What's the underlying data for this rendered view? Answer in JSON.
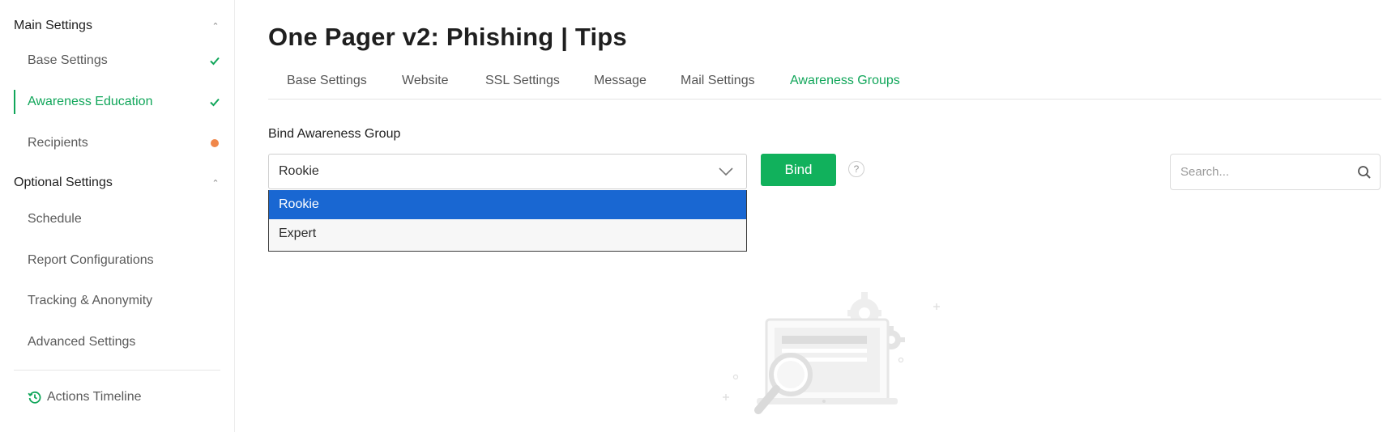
{
  "sidebar": {
    "main_section": "Main Settings",
    "main_items": [
      {
        "label": "Base Settings",
        "status": "done"
      },
      {
        "label": "Awareness Education",
        "status": "done-active"
      },
      {
        "label": "Recipients",
        "status": "pending"
      }
    ],
    "optional_section": "Optional Settings",
    "optional_items": [
      {
        "label": "Schedule"
      },
      {
        "label": "Report Configurations"
      },
      {
        "label": "Tracking & Anonymity"
      },
      {
        "label": "Advanced Settings"
      }
    ],
    "actions_label": "Actions Timeline"
  },
  "page": {
    "title": "One Pager v2: Phishing | Tips"
  },
  "tabs": [
    {
      "label": "Base Settings"
    },
    {
      "label": "Website"
    },
    {
      "label": "SSL Settings"
    },
    {
      "label": "Message"
    },
    {
      "label": "Mail Settings"
    },
    {
      "label": "Awareness Groups",
      "active": true
    }
  ],
  "bind_group": {
    "label": "Bind Awareness Group",
    "selected": "Rookie",
    "options": [
      "Rookie",
      "Expert"
    ],
    "bind_label": "Bind",
    "help": "?"
  },
  "search": {
    "placeholder": "Search..."
  },
  "colors": {
    "accent": "#11a65a",
    "button": "#11b15c",
    "warning_dot": "#f0874a",
    "option_highlight": "#1967d2"
  },
  "icons": {
    "section_toggle": "chevron-up-icon",
    "complete": "check-icon",
    "pending": "status-dot-icon",
    "timeline": "history-icon",
    "dropdown": "chevron-down-icon",
    "help": "help-icon",
    "search": "search-icon"
  }
}
